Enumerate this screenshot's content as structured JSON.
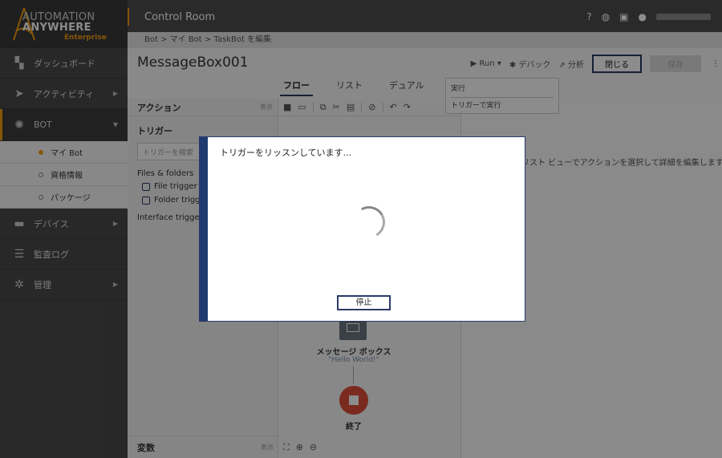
{
  "app": {
    "logo_line1": "AUTOMATION",
    "logo_line2": "ANYWHERE",
    "logo_line3": "Enterprise",
    "title": "Control Room"
  },
  "sidebar": {
    "items": [
      {
        "label": "ダッシュボード",
        "icon": "dashboard-icon"
      },
      {
        "label": "アクティビティ",
        "icon": "activity-icon"
      },
      {
        "label": "BOT",
        "icon": "bot-icon"
      },
      {
        "label": "デバイス",
        "icon": "device-icon"
      },
      {
        "label": "監査ログ",
        "icon": "audit-log-icon"
      },
      {
        "label": "管理",
        "icon": "admin-icon"
      }
    ],
    "sub_items": [
      {
        "label": "マイ Bot"
      },
      {
        "label": "資格情報"
      },
      {
        "label": "パッケージ"
      }
    ]
  },
  "breadcrumb": "Bot  >  マイ Bot  >  TaskBot を編集",
  "editor": {
    "bot_name": "MessageBox001",
    "run_label": "Run",
    "debug_label": "デバック",
    "analyze_label": "分析",
    "close_label": "閉じる",
    "save_label": "保存",
    "tabs": [
      "フロー",
      "リスト",
      "デュアル"
    ],
    "run_menu": [
      "実行",
      "トリガーで実行"
    ]
  },
  "left_panel": {
    "header": "アクション",
    "show_label": "表示",
    "section": "トリガー",
    "search_placeholder": "トリガーを検索",
    "group1": "Files & folders",
    "group1_items": [
      "File trigger",
      "Folder trigger"
    ],
    "group2": "Interface trigger",
    "variables_header": "変数",
    "variables_show": "表示"
  },
  "canvas": {
    "node_label": "メッセージ ボックス",
    "node_sub": "\"Hello World!\"",
    "end_label": "終了"
  },
  "right_panel": {
    "hint": "リスト ビューでアクションを選択して詳細を編集します"
  },
  "modal": {
    "title": "トリガーをリッスンしています...",
    "stop_label": "停止"
  },
  "colors": {
    "accent": "#f39c12",
    "primary": "#2b3a67",
    "end_node": "#e14d3b"
  }
}
